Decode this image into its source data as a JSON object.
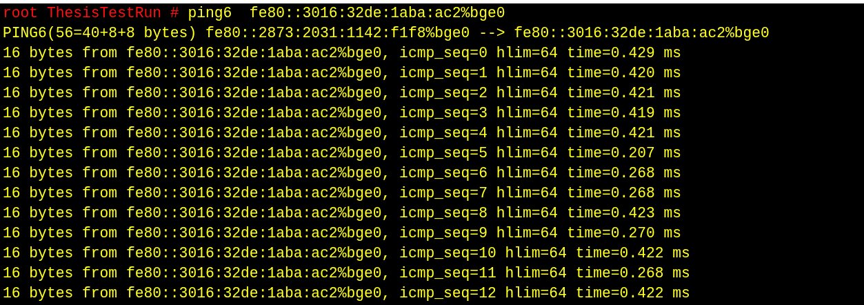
{
  "prompt": {
    "user": "root",
    "host": "ThesisTestRun",
    "symbol": "#",
    "command": "ping6  fe80::3016:32de:1aba:ac2%bge0"
  },
  "output": [
    "PING6(56=40+8+8 bytes) fe80::2873:2031:1142:f1f8%bge0 --> fe80::3016:32de:1aba:ac2%bge0",
    "16 bytes from fe80::3016:32de:1aba:ac2%bge0, icmp_seq=0 hlim=64 time=0.429 ms",
    "16 bytes from fe80::3016:32de:1aba:ac2%bge0, icmp_seq=1 hlim=64 time=0.420 ms",
    "16 bytes from fe80::3016:32de:1aba:ac2%bge0, icmp_seq=2 hlim=64 time=0.421 ms",
    "16 bytes from fe80::3016:32de:1aba:ac2%bge0, icmp_seq=3 hlim=64 time=0.419 ms",
    "16 bytes from fe80::3016:32de:1aba:ac2%bge0, icmp_seq=4 hlim=64 time=0.421 ms",
    "16 bytes from fe80::3016:32de:1aba:ac2%bge0, icmp_seq=5 hlim=64 time=0.207 ms",
    "16 bytes from fe80::3016:32de:1aba:ac2%bge0, icmp_seq=6 hlim=64 time=0.268 ms",
    "16 bytes from fe80::3016:32de:1aba:ac2%bge0, icmp_seq=7 hlim=64 time=0.268 ms",
    "16 bytes from fe80::3016:32de:1aba:ac2%bge0, icmp_seq=8 hlim=64 time=0.423 ms",
    "16 bytes from fe80::3016:32de:1aba:ac2%bge0, icmp_seq=9 hlim=64 time=0.270 ms",
    "16 bytes from fe80::3016:32de:1aba:ac2%bge0, icmp_seq=10 hlim=64 time=0.422 ms",
    "16 bytes from fe80::3016:32de:1aba:ac2%bge0, icmp_seq=11 hlim=64 time=0.268 ms",
    "16 bytes from fe80::3016:32de:1aba:ac2%bge0, icmp_seq=12 hlim=64 time=0.422 ms"
  ]
}
